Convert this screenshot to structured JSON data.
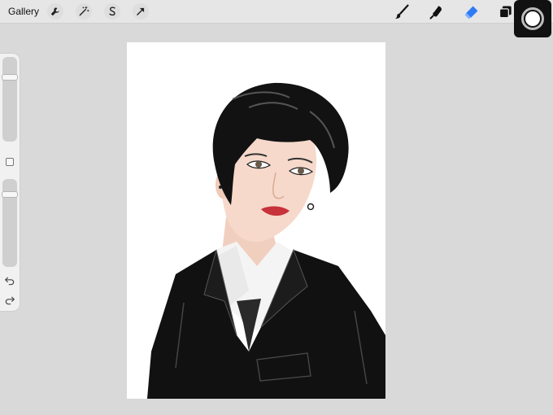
{
  "topbar": {
    "gallery_label": "Gallery",
    "left_tools": [
      {
        "name": "actions",
        "icon": "wrench-icon"
      },
      {
        "name": "adjustments",
        "icon": "magic-wand-icon"
      },
      {
        "name": "selection",
        "icon": "selection-s-icon"
      },
      {
        "name": "transform",
        "icon": "arrow-icon"
      }
    ],
    "right_tools": [
      {
        "name": "brush",
        "icon": "brush-icon"
      },
      {
        "name": "smudge",
        "icon": "smudge-icon"
      },
      {
        "name": "eraser",
        "icon": "eraser-icon",
        "active": true,
        "accent": "#2f7bf6"
      },
      {
        "name": "layers",
        "icon": "layers-icon"
      }
    ],
    "color": {
      "current": "#ffffff"
    }
  },
  "sidebar": {
    "brush_size_level": 0.22,
    "brush_opacity_level": 0.15,
    "modifier_icon": "square-modifier-icon",
    "undo_icon": "undo-icon",
    "redo_icon": "redo-icon"
  },
  "canvas": {
    "background": "#ffffff",
    "artwork": "portrait-illustration"
  }
}
